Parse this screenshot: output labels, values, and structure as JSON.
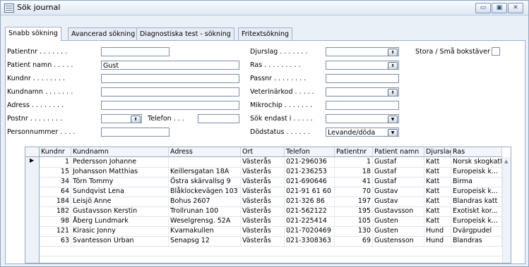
{
  "window": {
    "title": "Sök journal"
  },
  "tabs": [
    {
      "label": "Snabb sökning"
    },
    {
      "label": "Avancerad sökning"
    },
    {
      "label": "Diagnostiska test - sökning"
    },
    {
      "label": "Fritextsökning"
    }
  ],
  "form": {
    "patientnr": {
      "label": "Patientnr . . . . . . .",
      "value": ""
    },
    "patient_namn": {
      "label": "Patient namn . . . . .",
      "value": "Gust"
    },
    "kundnr": {
      "label": "Kundnr . . . . . . . .",
      "value": ""
    },
    "kundnamn": {
      "label": "Kundnamn . . . . . . .",
      "value": ""
    },
    "adress": {
      "label": "Adress . . . . . . . .",
      "value": ""
    },
    "postnr": {
      "label": "Postnr . . . . . . . .",
      "value": ""
    },
    "telefon": {
      "label": "Telefon . . .",
      "value": ""
    },
    "personnummer": {
      "label": "Personnummer . . . .",
      "value": ""
    },
    "djurslag": {
      "label": "Djurslag . . . . . . .",
      "value": ""
    },
    "ras": {
      "label": "Ras . . . . . . . . .",
      "value": ""
    },
    "passnr": {
      "label": "Passnr . . . . . . . .",
      "value": ""
    },
    "veterinarkod": {
      "label": "Veterinärkod . . . . .",
      "value": ""
    },
    "mikrochip": {
      "label": "Mikrochip . . . . . . .",
      "value": ""
    },
    "sok_endast_i": {
      "label": "Sök endast i . . . . .",
      "value": ""
    },
    "dodstatus": {
      "label": "Dödstatus . . . . . .",
      "value": "Levande/döda"
    },
    "stora_sma": {
      "label": "Stora / Små bokstäver",
      "checked": false
    }
  },
  "table": {
    "columns": [
      "Kundnr",
      "Kundnamn",
      "Adress",
      "Ort",
      "Telefon",
      "Patientnr",
      "Patient namn",
      "Djurslag",
      "Ras"
    ],
    "rows": [
      [
        "1",
        "Pedersson Johanne",
        "",
        "Västerås",
        "021-296036",
        "1",
        "Gustaf",
        "Katt",
        "Norsk skogkatt"
      ],
      [
        "15",
        "Johansson Matthias",
        "Keillersgatan 18A",
        "Västerås",
        "021-236253",
        "18",
        "Gustaf",
        "Katt",
        "Europeisk k..."
      ],
      [
        "34",
        "Törn Tommy",
        "Östra skärvallsg 9",
        "Västerås",
        "021-690646",
        "41",
        "Gustaf",
        "Katt",
        "Birma"
      ],
      [
        "64",
        "Sundqvist Lena",
        "Blåklockevägen 103",
        "Västerås",
        "021-91 61 60",
        "70",
        "Gustav",
        "Katt",
        "Europeisk k..."
      ],
      [
        "184",
        "Leisjö Anne",
        "Bohus 2607",
        "Västerås",
        "021-326 86",
        "197",
        "Gustav",
        "Katt",
        "Blandras katt"
      ],
      [
        "182",
        "Gustavsson Kerstin",
        "Trollrunan 100",
        "Västerås",
        "021-562122",
        "195",
        "Gustavsson",
        "Katt",
        "Exotiskt kor..."
      ],
      [
        "98",
        "Åberg Lundmark",
        "Weselgrensg. 52A",
        "Västerås",
        "021-225414",
        "105",
        "Gusten",
        "Katt",
        "Europeisk k..."
      ],
      [
        "121",
        "Kirasic Jonny",
        "Kvarnakullen",
        "Västerås",
        "021-7020469",
        "130",
        "Gusten",
        "Hund",
        "Dvärgpudel"
      ],
      [
        "63",
        "Svantesson Urban",
        "Senapsg 12",
        "Västerås",
        "021-3308363",
        "69",
        "Gustensson",
        "Hund",
        "Blandras"
      ]
    ]
  }
}
